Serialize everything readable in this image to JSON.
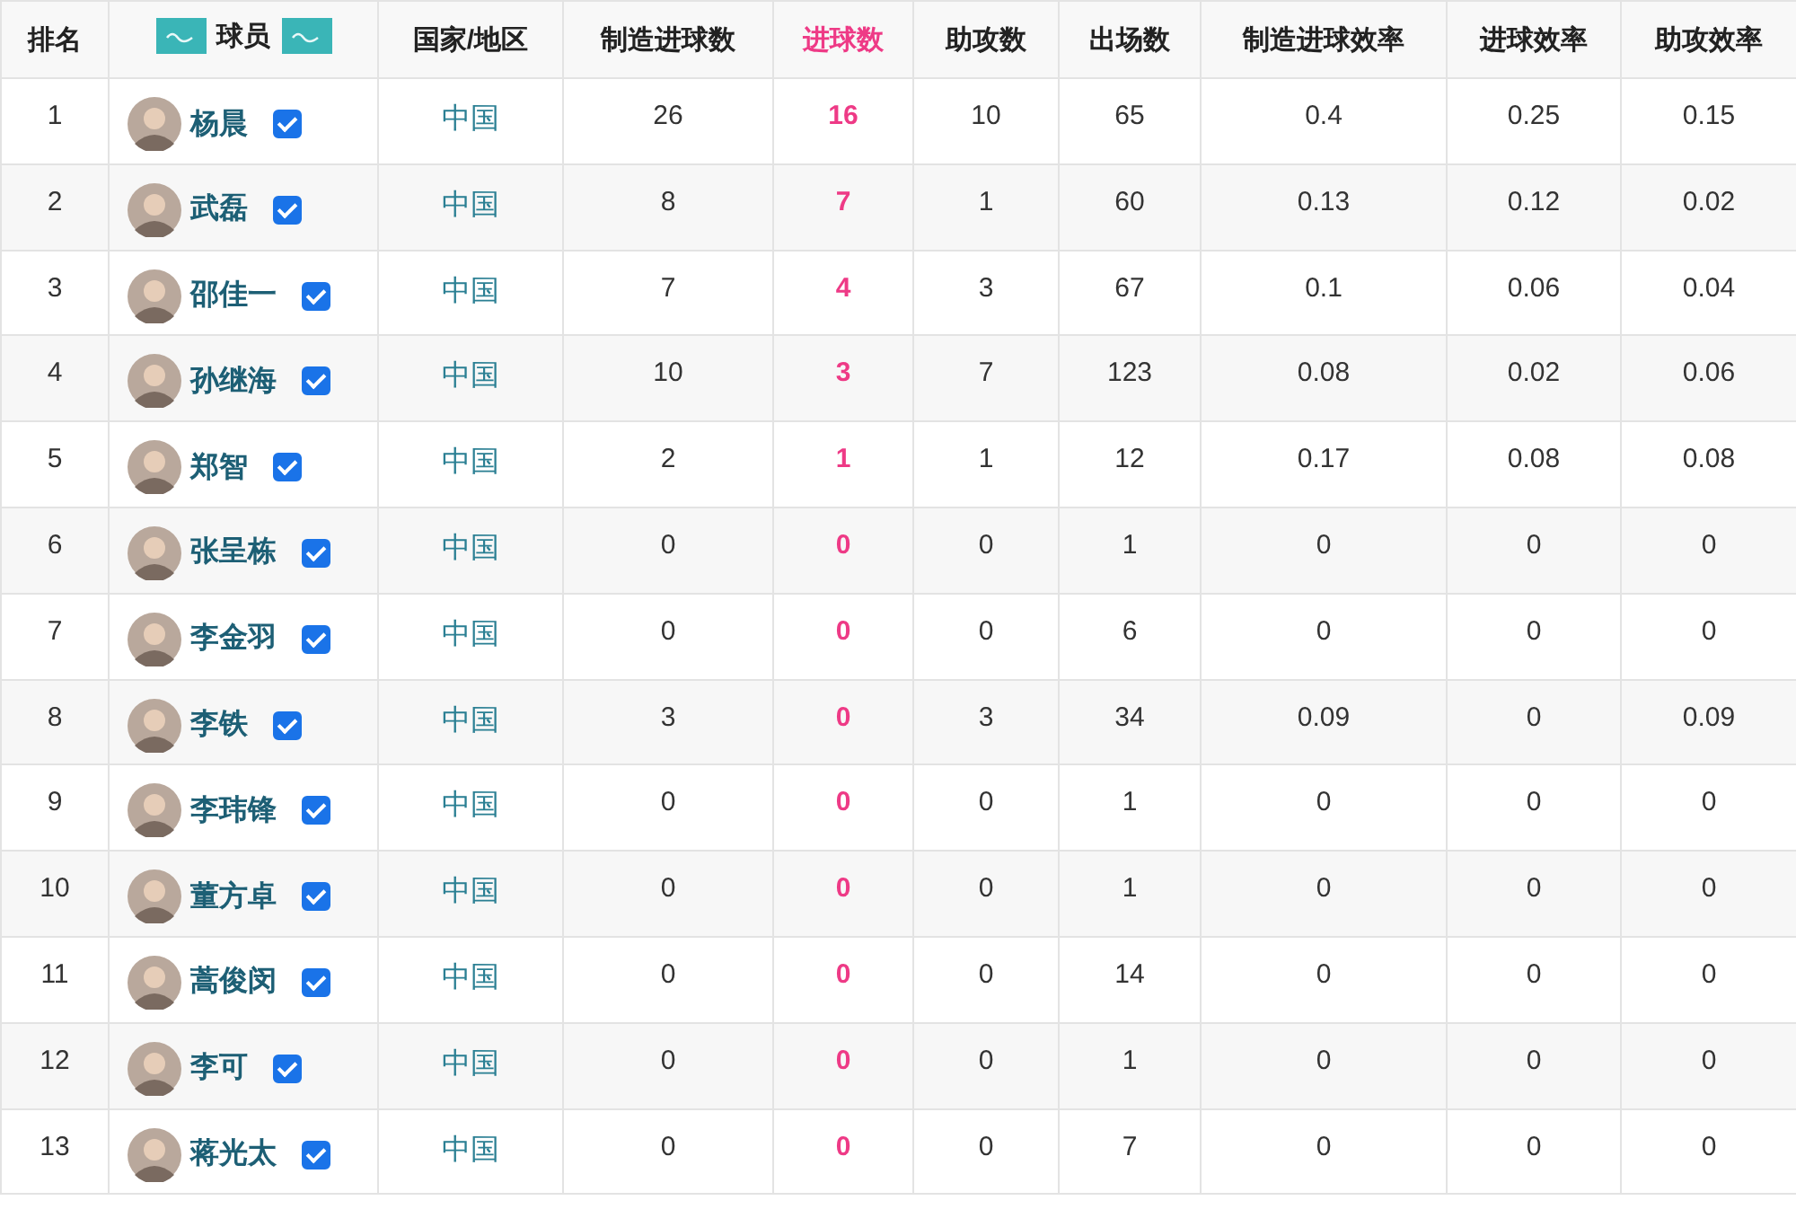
{
  "columns": [
    {
      "label": "排名",
      "highlighted": false
    },
    {
      "label": "球员",
      "highlighted": false
    },
    {
      "label": "国家/地区",
      "highlighted": false
    },
    {
      "label": "制造进球数",
      "highlighted": false
    },
    {
      "label": "进球数",
      "highlighted": true
    },
    {
      "label": "助攻数",
      "highlighted": false
    },
    {
      "label": "出场数",
      "highlighted": false
    },
    {
      "label": "制造进球效率",
      "highlighted": false
    },
    {
      "label": "进球效率",
      "highlighted": false
    },
    {
      "label": "助攻效率",
      "highlighted": false
    }
  ],
  "rows": [
    {
      "rank": "1",
      "name": "杨晨",
      "checked": true,
      "country": "中国",
      "stats": [
        "26",
        "16",
        "10",
        "65",
        "0.4",
        "0.25",
        "0.15"
      ]
    },
    {
      "rank": "2",
      "name": "武磊",
      "checked": true,
      "country": "中国",
      "stats": [
        "8",
        "7",
        "1",
        "60",
        "0.13",
        "0.12",
        "0.02"
      ]
    },
    {
      "rank": "3",
      "name": "邵佳一",
      "checked": true,
      "country": "中国",
      "stats": [
        "7",
        "4",
        "3",
        "67",
        "0.1",
        "0.06",
        "0.04"
      ]
    },
    {
      "rank": "4",
      "name": "孙继海",
      "checked": true,
      "country": "中国",
      "stats": [
        "10",
        "3",
        "7",
        "123",
        "0.08",
        "0.02",
        "0.06"
      ]
    },
    {
      "rank": "5",
      "name": "郑智",
      "checked": true,
      "country": "中国",
      "stats": [
        "2",
        "1",
        "1",
        "12",
        "0.17",
        "0.08",
        "0.08"
      ]
    },
    {
      "rank": "6",
      "name": "张呈栋",
      "checked": true,
      "country": "中国",
      "stats": [
        "0",
        "0",
        "0",
        "1",
        "0",
        "0",
        "0"
      ]
    },
    {
      "rank": "7",
      "name": "李金羽",
      "checked": true,
      "country": "中国",
      "stats": [
        "0",
        "0",
        "0",
        "6",
        "0",
        "0",
        "0"
      ]
    },
    {
      "rank": "8",
      "name": "李铁",
      "checked": true,
      "country": "中国",
      "stats": [
        "3",
        "0",
        "3",
        "34",
        "0.09",
        "0",
        "0.09"
      ]
    },
    {
      "rank": "9",
      "name": "李玮锋",
      "checked": true,
      "country": "中国",
      "stats": [
        "0",
        "0",
        "0",
        "1",
        "0",
        "0",
        "0"
      ]
    },
    {
      "rank": "10",
      "name": "董方卓",
      "checked": true,
      "country": "中国",
      "stats": [
        "0",
        "0",
        "0",
        "1",
        "0",
        "0",
        "0"
      ]
    },
    {
      "rank": "11",
      "name": "蒿俊闵",
      "checked": true,
      "country": "中国",
      "stats": [
        "0",
        "0",
        "0",
        "14",
        "0",
        "0",
        "0"
      ]
    },
    {
      "rank": "12",
      "name": "李可",
      "checked": true,
      "country": "中国",
      "stats": [
        "0",
        "0",
        "0",
        "1",
        "0",
        "0",
        "0"
      ]
    },
    {
      "rank": "13",
      "name": "蒋光太",
      "checked": true,
      "country": "中国",
      "stats": [
        "0",
        "0",
        "0",
        "7",
        "0",
        "0",
        "0"
      ]
    }
  ]
}
